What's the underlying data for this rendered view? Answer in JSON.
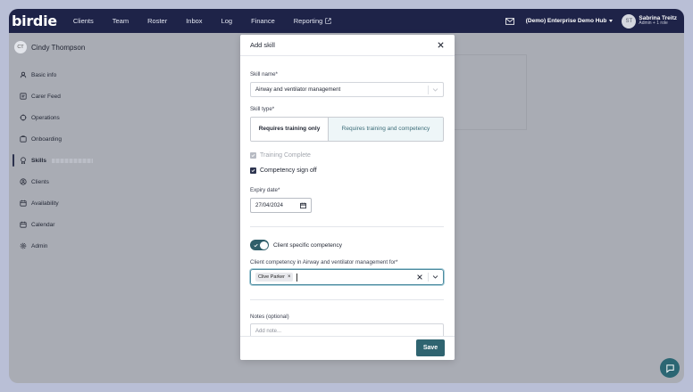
{
  "brand": {
    "logo": "birdie",
    "accent": "#2f6470",
    "nav_bg": "#1e2348"
  },
  "nav": {
    "items": [
      "Clients",
      "Team",
      "Roster",
      "Inbox",
      "Log",
      "Finance",
      "Reporting"
    ],
    "org": "(Demo) Enterprise Demo Hub",
    "user_initials": "ST",
    "user_name": "Sabrina Treitz",
    "user_role": "Admin + 1 role"
  },
  "sidebar": {
    "initials": "CT",
    "name": "Cindy Thompson",
    "items": [
      {
        "label": "Basic info",
        "icon": "person-icon"
      },
      {
        "label": "Carer Feed",
        "icon": "feed-icon"
      },
      {
        "label": "Operations",
        "icon": "operations-icon"
      },
      {
        "label": "Onboarding",
        "icon": "onboarding-icon"
      },
      {
        "label": "Skills",
        "icon": "skills-icon"
      },
      {
        "label": "Clients",
        "icon": "clients-icon"
      },
      {
        "label": "Availability",
        "icon": "calendar-icon"
      },
      {
        "label": "Calendar",
        "icon": "calendar-icon"
      },
      {
        "label": "Admin",
        "icon": "gear-icon"
      }
    ]
  },
  "modal": {
    "title": "Add skill",
    "skill_name_label": "Skill name*",
    "skill_name_value": "Airway and ventilator management",
    "skill_type_label": "Skill type*",
    "type_options": [
      "Requires training only",
      "Requires training and competency"
    ],
    "selected_type": "Requires training and competency",
    "training_complete_label": "Training Complete",
    "training_complete_checked": true,
    "competency_label": "Competency sign off",
    "competency_checked": true,
    "expiry_label": "Expiry date*",
    "expiry_value": "27/04/2024",
    "client_specific_label": "Client specific competency",
    "client_specific_on": true,
    "client_for_label": "Client competency in Airway and ventilator management for*",
    "selected_clients": [
      "Clive Parker"
    ],
    "notes_label": "Notes (optional)",
    "notes_placeholder": "Add note...",
    "save_label": "Save"
  }
}
